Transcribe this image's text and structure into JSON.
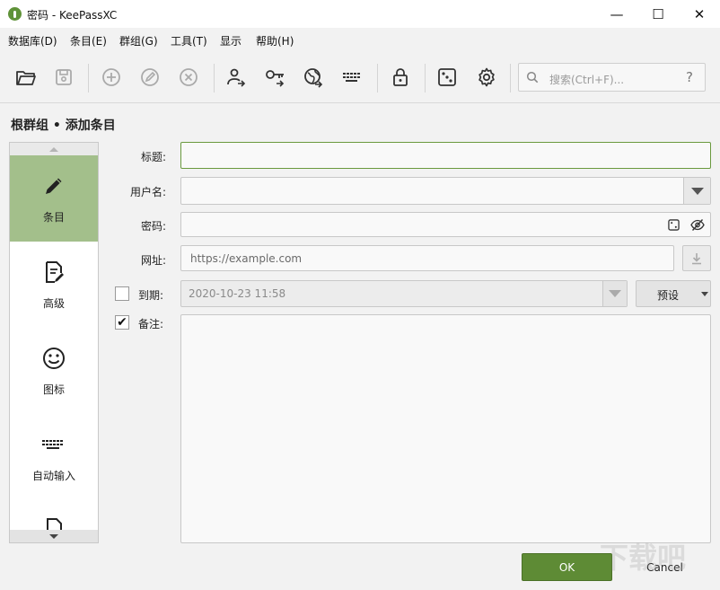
{
  "window": {
    "title": "密码 - KeePassXC",
    "min": "—",
    "max": "☐",
    "close": "✕"
  },
  "menu": [
    "数据库(D)",
    "条目(E)",
    "群组(G)",
    "工具(T)",
    "显示",
    "帮助(H)"
  ],
  "search": {
    "placeholder": "搜索(Ctrl+F)...",
    "help": "?"
  },
  "breadcrumb": "根群组 • 添加条目",
  "categories": [
    "条目",
    "高级",
    "图标",
    "自动输入"
  ],
  "form": {
    "title_label": "标题:",
    "title_value": "",
    "username_label": "用户名:",
    "username_value": "",
    "password_label": "密码:",
    "password_value": "",
    "url_label": "网址:",
    "url_placeholder": "https://example.com",
    "expiry_label": "到期:",
    "expiry_checked": false,
    "expiry_value": "2020-10-23 11:58",
    "preset_label": "预设",
    "notes_label": "备注:",
    "notes_checked": true,
    "notes_value": ""
  },
  "buttons": {
    "ok": "OK",
    "cancel": "Cancel"
  },
  "watermark": "下载吧",
  "colors": {
    "accent": "#5e8b35",
    "active_category": "#a3bf8b",
    "focus_border": "#6a9a3f"
  }
}
